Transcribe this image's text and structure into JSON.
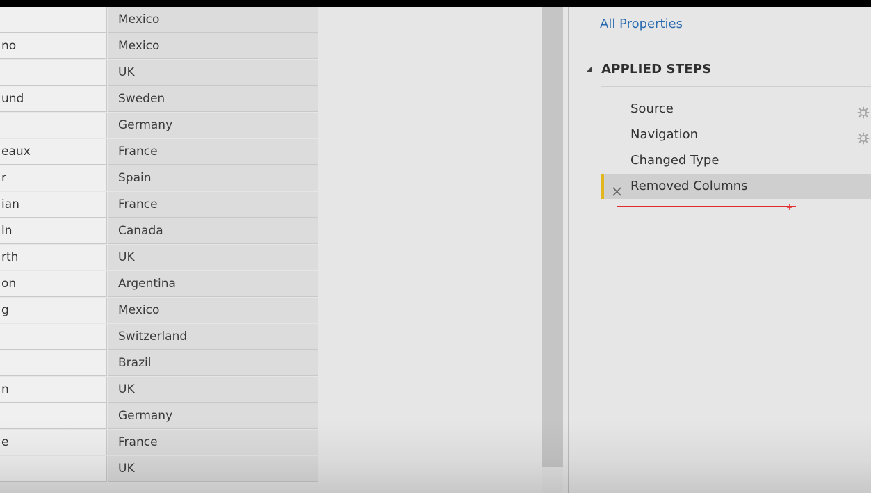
{
  "grid": {
    "rows": [
      {
        "col_a": "",
        "col_b": "Mexico"
      },
      {
        "col_a": "no",
        "col_b": "Mexico"
      },
      {
        "col_a": "",
        "col_b": "UK"
      },
      {
        "col_a": "und",
        "col_b": "Sweden"
      },
      {
        "col_a": "",
        "col_b": "Germany"
      },
      {
        "col_a": "eaux",
        "col_b": "France"
      },
      {
        "col_a": "r",
        "col_b": "Spain"
      },
      {
        "col_a": "ian",
        "col_b": "France"
      },
      {
        "col_a": "ln",
        "col_b": "Canada"
      },
      {
        "col_a": "rth",
        "col_b": "UK"
      },
      {
        "col_a": "on",
        "col_b": "Argentina"
      },
      {
        "col_a": "g",
        "col_b": "Mexico"
      },
      {
        "col_a": "",
        "col_b": "Switzerland"
      },
      {
        "col_a": "",
        "col_b": "Brazil"
      },
      {
        "col_a": "n",
        "col_b": "UK"
      },
      {
        "col_a": "",
        "col_b": "Germany"
      },
      {
        "col_a": "e",
        "col_b": "France"
      },
      {
        "col_a": "",
        "col_b": "UK"
      }
    ]
  },
  "query_settings": {
    "all_properties_link": "All Properties",
    "applied_steps_title": "APPLIED STEPS",
    "steps": [
      {
        "label": "Source",
        "has_settings": true,
        "selected": false
      },
      {
        "label": "Navigation",
        "has_settings": true,
        "selected": false
      },
      {
        "label": "Changed Type",
        "has_settings": false,
        "selected": false
      },
      {
        "label": "Removed Columns",
        "has_settings": false,
        "selected": true
      }
    ]
  },
  "colors": {
    "link": "#2b6cb0",
    "selected_step_accent": "#e1b61f",
    "annotation_red": "#e32c2c"
  },
  "icons": {
    "collapse": "triangle-down-icon",
    "step_settings": "gear-icon",
    "step_delete": "x-icon"
  }
}
